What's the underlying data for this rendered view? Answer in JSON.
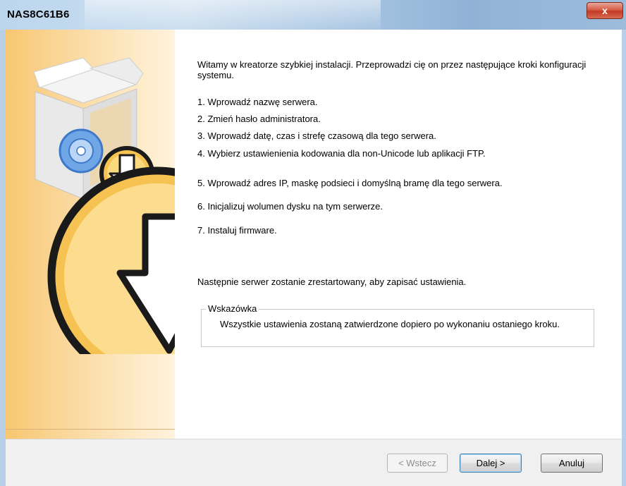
{
  "window": {
    "title": "NAS8C61B6",
    "close_glyph": "x"
  },
  "content": {
    "intro": "Witamy w kreatorze szybkiej instalacji. Przeprowadzi cię on przez następujące kroki konfiguracji systemu.",
    "steps": [
      "1. Wprowadź nazwę serwera.",
      "2. Zmień hasło administratora.",
      "3. Wprowadź datę, czas i strefę czasową dla tego serwera.",
      "4. Wybierz ustawienienia kodowania dla non-Unicode lub aplikacji FTP.",
      "5. Wprowadź adres IP, maskę podsieci i domyślną bramę dla tego serwera.",
      "6. Inicjalizuj wolumen dysku na tym serwerze.",
      "7. Instaluj firmware."
    ],
    "restart_note": "Następnie serwer zostanie zrestartowany, aby zapisać ustawienia.",
    "tip": {
      "title": "Wskazówka",
      "text": "Wszystkie ustawienia zostaną zatwierdzone dopiero po wykonaniu ostaniego kroku."
    }
  },
  "buttons": {
    "back": "< Wstecz",
    "next": "Dalej >",
    "cancel": "Anuluj"
  },
  "icons": [
    "install-box-icon",
    "cd-disc-icon",
    "download-arrow-icon",
    "close-icon"
  ],
  "colors": {
    "sidebar": "#f9cf85",
    "titlebar": "#b7cfe7",
    "close_button": "#c9452f"
  }
}
